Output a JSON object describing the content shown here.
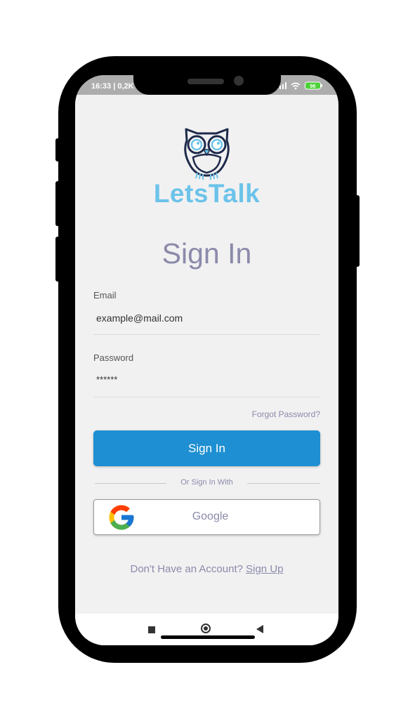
{
  "status": {
    "time": "16:33 | 0,2K",
    "battery": "96"
  },
  "brand": {
    "name": "LetsTalk"
  },
  "title": "Sign In",
  "email": {
    "label": "Email",
    "value": "example@mail.com"
  },
  "password": {
    "label": "Password",
    "value": "******"
  },
  "forgot_label": "Forgot Password?",
  "signin_label": "Sign In",
  "divider_text": "Or Sign In With",
  "google_label": "Google",
  "signup": {
    "prompt": "Don't Have an Account?",
    "link": "Sign Up"
  },
  "colors": {
    "accent": "#1e8fd2",
    "brand": "#6cc3e9",
    "muted_text": "#8b8aaa",
    "background": "#f1f1f2"
  },
  "icons": [
    "owl-logo-icon",
    "google-icon",
    "signal-icon",
    "wifi-icon",
    "battery-icon",
    "nav-recents-icon",
    "nav-home-icon",
    "nav-back-icon"
  ]
}
